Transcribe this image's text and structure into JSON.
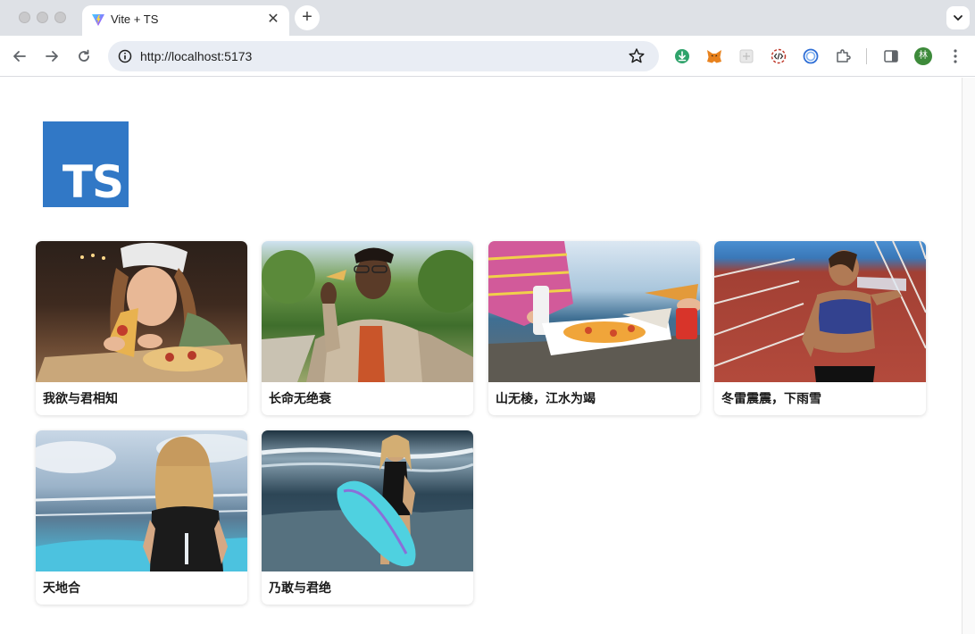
{
  "browser": {
    "tab": {
      "title": "Vite + TS"
    },
    "address_bar": {
      "url": "http://localhost:5173"
    },
    "profile_initial": "林"
  },
  "page": {
    "logo": {
      "text": "TS",
      "color": "#3178c6"
    },
    "cards": [
      {
        "title": "我欲与君相知",
        "image": "woman-eating-pizza-photo"
      },
      {
        "title": "长命无绝衰",
        "image": "man-eating-pizza-photo"
      },
      {
        "title": "山无棱，江水为竭",
        "image": "pizza-by-the-sea-photo"
      },
      {
        "title": "冬雷震震，下雨雪",
        "image": "athlete-drinking-water-photo"
      },
      {
        "title": "天地合",
        "image": "surfer-looking-at-sea-photo"
      },
      {
        "title": "乃敢与君绝",
        "image": "surfer-with-board-photo"
      }
    ]
  }
}
